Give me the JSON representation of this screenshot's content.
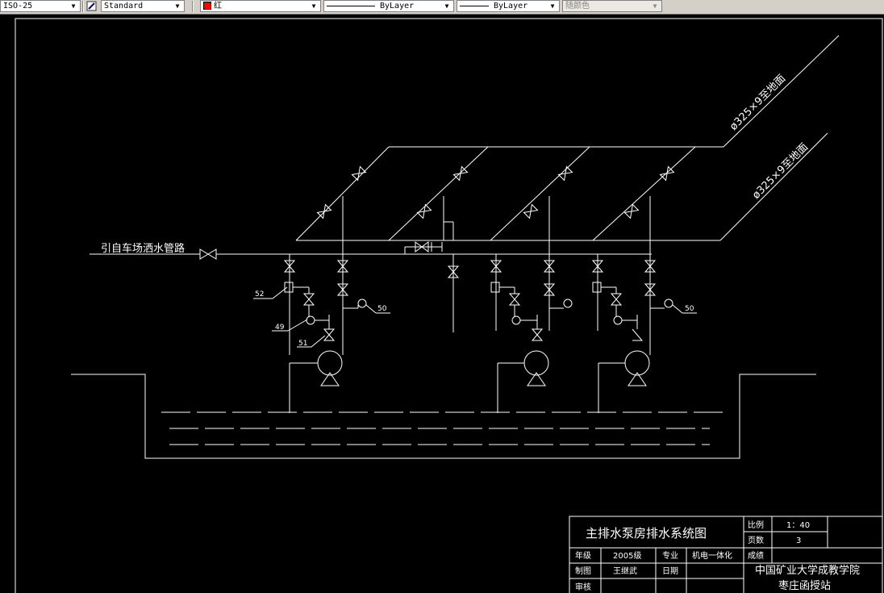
{
  "toolbar": {
    "dimstyle": "ISO-25",
    "textstyle": "Standard",
    "color": "红",
    "linetype": "ByLayer",
    "lineweight": "ByLayer",
    "plotstyle": "随颜色"
  },
  "drawing": {
    "source_label": "引自车场洒水管路",
    "pipe_label_1": "ø325×9至地面",
    "pipe_label_2": "ø325×9至地面",
    "callouts": {
      "c52": "52",
      "c49": "49",
      "c51": "51",
      "c50a": "50",
      "c50b": "50"
    }
  },
  "title_block": {
    "title": "主排水泵房排水系统图",
    "scale_label": "比例",
    "scale_value": "1：40",
    "pages_label": "页数",
    "pages_value": "3",
    "grade_label": "成绩",
    "year_label": "年级",
    "year_value": "2005级",
    "major_label": "专业",
    "major_value": "机电一体化",
    "drawn_label": "制图",
    "drawn_value": "王继武",
    "date_label": "日期",
    "check_label": "审核",
    "school_line1": "中国矿业大学成教学院",
    "school_line2": "枣庄函授站"
  }
}
